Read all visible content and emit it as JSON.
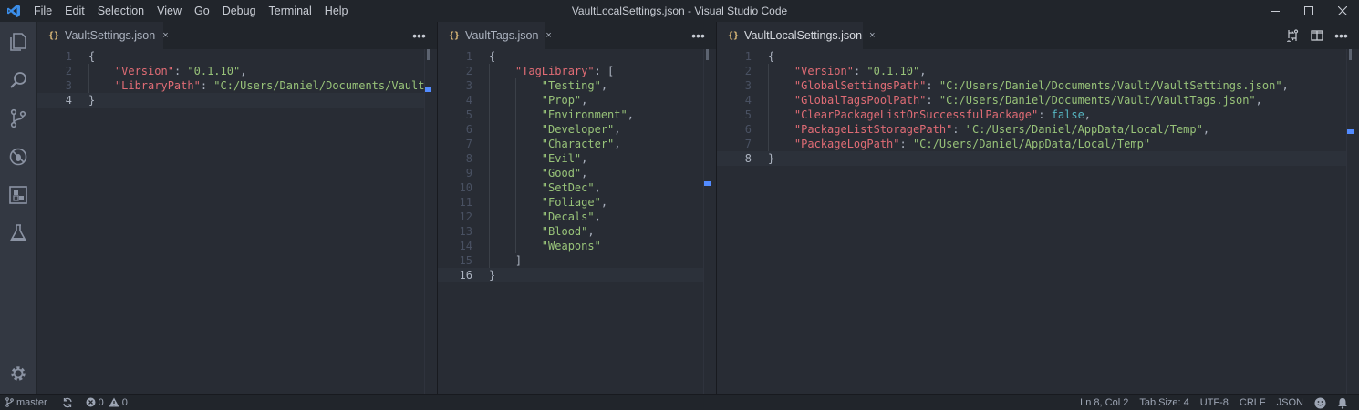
{
  "window": {
    "title": "VaultLocalSettings.json - Visual Studio Code",
    "menu": [
      "File",
      "Edit",
      "Selection",
      "View",
      "Go",
      "Debug",
      "Terminal",
      "Help"
    ]
  },
  "colors": {
    "accent": "#528bff",
    "key": "#e06c75",
    "string": "#98c379",
    "boolean": "#56b6c2",
    "tab_icon": "#e5c07b"
  },
  "activity_icons": [
    "explorer-icon",
    "search-icon",
    "source-control-icon",
    "debug-icon",
    "extensions-icon",
    "test-flask-icon",
    "settings-gear-icon"
  ],
  "groups": [
    {
      "tab": {
        "label": "VaultSettings.json",
        "icon": "{}",
        "close": "×"
      },
      "current_line": 4,
      "lines": [
        [
          {
            "t": "{",
            "c": ""
          }
        ],
        [
          {
            "t": "    ",
            "c": ""
          },
          {
            "t": "\"Version\"",
            "c": "k"
          },
          {
            "t": ": ",
            "c": ""
          },
          {
            "t": "\"0.1.10\"",
            "c": "s"
          },
          {
            "t": ",",
            "c": ""
          }
        ],
        [
          {
            "t": "    ",
            "c": ""
          },
          {
            "t": "\"LibraryPath\"",
            "c": "k"
          },
          {
            "t": ": ",
            "c": ""
          },
          {
            "t": "\"C:/Users/Daniel/Documents/Vault\"",
            "c": "s"
          }
        ],
        [
          {
            "t": "}",
            "c": ""
          }
        ]
      ]
    },
    {
      "tab": {
        "label": "VaultTags.json",
        "icon": "{}",
        "close": "×"
      },
      "current_line": 16,
      "lines": [
        [
          {
            "t": "{",
            "c": ""
          }
        ],
        [
          {
            "t": "    ",
            "c": ""
          },
          {
            "t": "\"TagLibrary\"",
            "c": "k"
          },
          {
            "t": ": [",
            "c": ""
          }
        ],
        [
          {
            "t": "        ",
            "c": ""
          },
          {
            "t": "\"Testing\"",
            "c": "s"
          },
          {
            "t": ",",
            "c": ""
          }
        ],
        [
          {
            "t": "        ",
            "c": ""
          },
          {
            "t": "\"Prop\"",
            "c": "s"
          },
          {
            "t": ",",
            "c": ""
          }
        ],
        [
          {
            "t": "        ",
            "c": ""
          },
          {
            "t": "\"Environment\"",
            "c": "s"
          },
          {
            "t": ",",
            "c": ""
          }
        ],
        [
          {
            "t": "        ",
            "c": ""
          },
          {
            "t": "\"Developer\"",
            "c": "s"
          },
          {
            "t": ",",
            "c": ""
          }
        ],
        [
          {
            "t": "        ",
            "c": ""
          },
          {
            "t": "\"Character\"",
            "c": "s"
          },
          {
            "t": ",",
            "c": ""
          }
        ],
        [
          {
            "t": "        ",
            "c": ""
          },
          {
            "t": "\"Evil\"",
            "c": "s"
          },
          {
            "t": ",",
            "c": ""
          }
        ],
        [
          {
            "t": "        ",
            "c": ""
          },
          {
            "t": "\"Good\"",
            "c": "s"
          },
          {
            "t": ",",
            "c": ""
          }
        ],
        [
          {
            "t": "        ",
            "c": ""
          },
          {
            "t": "\"SetDec\"",
            "c": "s"
          },
          {
            "t": ",",
            "c": ""
          }
        ],
        [
          {
            "t": "        ",
            "c": ""
          },
          {
            "t": "\"Foliage\"",
            "c": "s"
          },
          {
            "t": ",",
            "c": ""
          }
        ],
        [
          {
            "t": "        ",
            "c": ""
          },
          {
            "t": "\"Decals\"",
            "c": "s"
          },
          {
            "t": ",",
            "c": ""
          }
        ],
        [
          {
            "t": "        ",
            "c": ""
          },
          {
            "t": "\"Blood\"",
            "c": "s"
          },
          {
            "t": ",",
            "c": ""
          }
        ],
        [
          {
            "t": "        ",
            "c": ""
          },
          {
            "t": "\"Weapons\"",
            "c": "s"
          }
        ],
        [
          {
            "t": "    ]",
            "c": ""
          }
        ],
        [
          {
            "t": "}",
            "c": ""
          }
        ]
      ]
    },
    {
      "tab": {
        "label": "VaultLocalSettings.json",
        "icon": "{}",
        "close": "×"
      },
      "current_line": 8,
      "lines": [
        [
          {
            "t": "{",
            "c": ""
          }
        ],
        [
          {
            "t": "    ",
            "c": ""
          },
          {
            "t": "\"Version\"",
            "c": "k"
          },
          {
            "t": ": ",
            "c": ""
          },
          {
            "t": "\"0.1.10\"",
            "c": "s"
          },
          {
            "t": ",",
            "c": ""
          }
        ],
        [
          {
            "t": "    ",
            "c": ""
          },
          {
            "t": "\"GlobalSettingsPath\"",
            "c": "k"
          },
          {
            "t": ": ",
            "c": ""
          },
          {
            "t": "\"C:/Users/Daniel/Documents/Vault/VaultSettings.json\"",
            "c": "s"
          },
          {
            "t": ",",
            "c": ""
          }
        ],
        [
          {
            "t": "    ",
            "c": ""
          },
          {
            "t": "\"GlobalTagsPoolPath\"",
            "c": "k"
          },
          {
            "t": ": ",
            "c": ""
          },
          {
            "t": "\"C:/Users/Daniel/Documents/Vault/VaultTags.json\"",
            "c": "s"
          },
          {
            "t": ",",
            "c": ""
          }
        ],
        [
          {
            "t": "    ",
            "c": ""
          },
          {
            "t": "\"ClearPackageListOnSuccessfulPackage\"",
            "c": "k"
          },
          {
            "t": ": ",
            "c": ""
          },
          {
            "t": "false",
            "c": "b"
          },
          {
            "t": ",",
            "c": ""
          }
        ],
        [
          {
            "t": "    ",
            "c": ""
          },
          {
            "t": "\"PackageListStoragePath\"",
            "c": "k"
          },
          {
            "t": ": ",
            "c": ""
          },
          {
            "t": "\"C:/Users/Daniel/AppData/Local/Temp\"",
            "c": "s"
          },
          {
            "t": ",",
            "c": ""
          }
        ],
        [
          {
            "t": "    ",
            "c": ""
          },
          {
            "t": "\"PackageLogPath\"",
            "c": "k"
          },
          {
            "t": ": ",
            "c": ""
          },
          {
            "t": "\"C:/Users/Daniel/AppData/Local/Temp\"",
            "c": "s"
          }
        ],
        [
          {
            "t": "}",
            "c": ""
          }
        ]
      ]
    }
  ],
  "status": {
    "branch": "master",
    "errors": "0",
    "warnings": "0",
    "position": "Ln 8, Col 2",
    "tab_size": "Tab Size: 4",
    "encoding": "UTF-8",
    "eol": "CRLF",
    "language": "JSON"
  }
}
